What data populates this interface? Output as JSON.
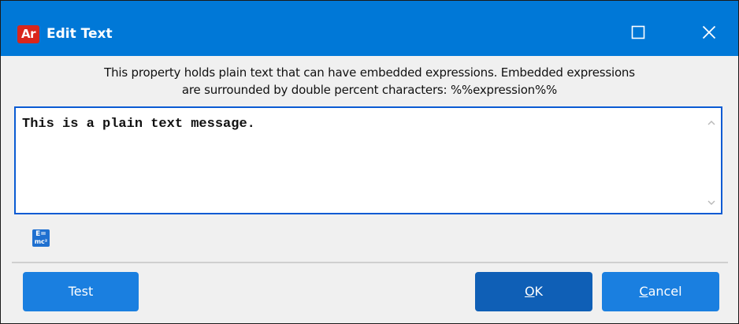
{
  "window": {
    "title": "Edit Text",
    "app_icon_text": "Ar",
    "app_icon_color": "#d9261c",
    "titlebar_color": "#0078d7"
  },
  "description": {
    "line1": "This property holds plain text that can have embedded expressions.  Embedded expressions",
    "line2": "are surrounded by double percent characters: %%expression%%"
  },
  "editor": {
    "value": "This is a plain text message."
  },
  "expression_button": {
    "icon": "formula-icon",
    "line1": "E=",
    "line2": "mc²"
  },
  "buttons": {
    "test": "Test",
    "ok_mnemonic": "O",
    "ok_rest": "K",
    "cancel_mnemonic": "C",
    "cancel_rest": "ancel",
    "accent_color": "#1a7fe0",
    "default_color": "#0f5fb6"
  },
  "icons": {
    "maximize": "maximize-icon",
    "close": "close-icon",
    "scroll_up": "chevron-up-icon",
    "scroll_down": "chevron-down-icon"
  }
}
